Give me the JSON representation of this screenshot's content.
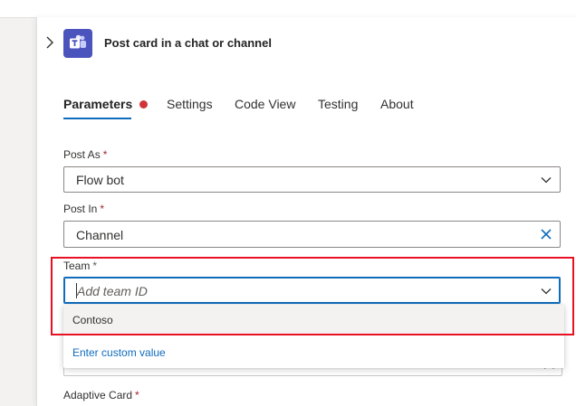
{
  "action": {
    "title": "Post card in a chat or channel",
    "icon": "teams-app-icon"
  },
  "tabs": [
    {
      "label": "Parameters",
      "active": true,
      "error_dot": true
    },
    {
      "label": "Settings"
    },
    {
      "label": "Code View"
    },
    {
      "label": "Testing"
    },
    {
      "label": "About"
    }
  ],
  "fields": {
    "post_as": {
      "label": "Post As",
      "required_mark": "*",
      "value": "Flow bot",
      "icon": "chevron-down-icon"
    },
    "post_in": {
      "label": "Post In",
      "required_mark": "*",
      "value": "Channel",
      "icon": "clear-icon"
    },
    "team": {
      "label": "Team",
      "required_mark": "*",
      "placeholder": "Add team ID",
      "icon": "chevron-down-icon"
    },
    "adaptive_card": {
      "label": "Adaptive Card",
      "required_mark": "*"
    }
  },
  "team_dropdown": {
    "options": [
      "Contoso"
    ],
    "custom_value_link": "Enter custom value"
  },
  "colors": {
    "accent": "#0f6cbd",
    "highlight_border": "#e81123",
    "error_dot": "#d13438",
    "teams_purple": "#4b53bc"
  }
}
